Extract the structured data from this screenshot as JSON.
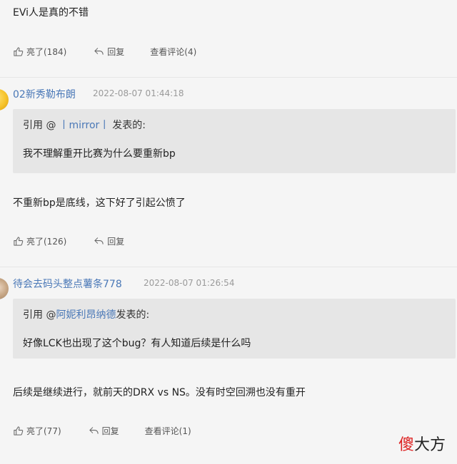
{
  "post1": {
    "text": "EVi人是真的不错",
    "like_label": "亮了(184)",
    "reply_label": "回复",
    "view_comments_label": "查看评论(4)"
  },
  "post2": {
    "username": "02新秀勒布朗",
    "timestamp": "2022-08-07 01:44:18",
    "quote_prefix": "引用 @",
    "quote_user": "丨mirror丨",
    "quote_suffix": "发表的:",
    "quote_text": "我不理解重开比赛为什么要重新bp",
    "text": "不重新bp是底线，这下好了引起公愤了",
    "like_label": "亮了(126)",
    "reply_label": "回复"
  },
  "post3": {
    "username": "待会去码头整点薯条778",
    "timestamp": "2022-08-07 01:26:54",
    "quote_prefix": "引用 @",
    "quote_user": "阿妮利昂纳德",
    "quote_suffix": "发表的:",
    "quote_text": "好像LCK也出现了这个bug？有人知道后续是什么吗",
    "text": "后续是继续进行，就前天的DRX vs NS。没有时空回溯也没有重开",
    "like_label": "亮了(77)",
    "reply_label": "回复",
    "view_comments_label": "查看评论(1)"
  },
  "watermark": {
    "red_char": "傻",
    "rest": "大方"
  },
  "icons": {
    "like": "thumbs-up-icon",
    "reply": "reply-arrow-icon"
  }
}
